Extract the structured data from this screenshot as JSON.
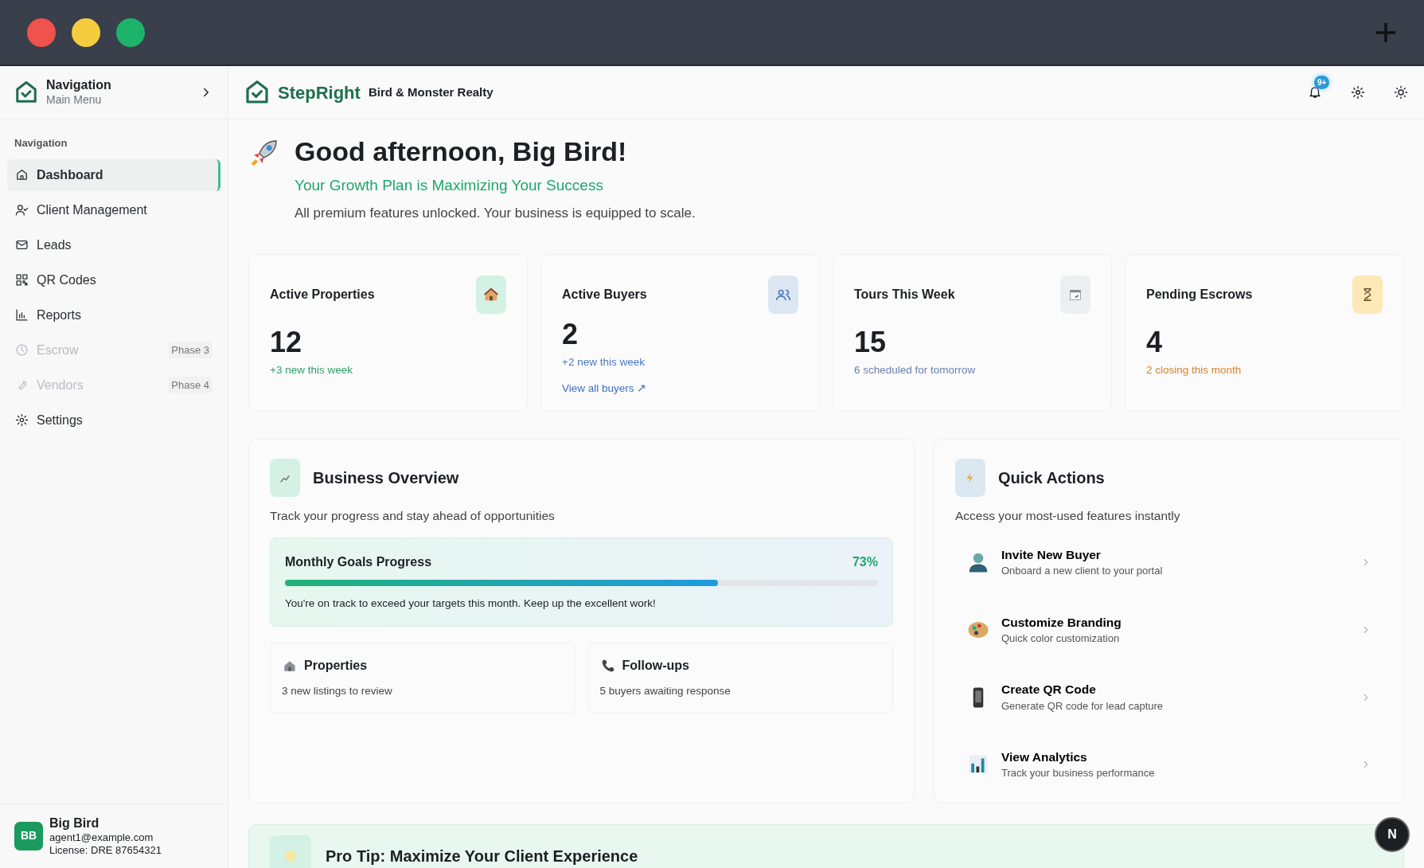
{
  "sidebar": {
    "header": {
      "title": "Navigation",
      "subtitle": "Main Menu"
    },
    "section_label": "Navigation",
    "items": [
      {
        "label": "Dashboard",
        "selected": true,
        "disabled": false
      },
      {
        "label": "Client Management",
        "selected": false,
        "disabled": false
      },
      {
        "label": "Leads",
        "selected": false,
        "disabled": false
      },
      {
        "label": "QR Codes",
        "selected": false,
        "disabled": false
      },
      {
        "label": "Reports",
        "selected": false,
        "disabled": false
      },
      {
        "label": "Escrow",
        "selected": false,
        "disabled": true,
        "badge": "Phase 3"
      },
      {
        "label": "Vendors",
        "selected": false,
        "disabled": true,
        "badge": "Phase 4"
      },
      {
        "label": "Settings",
        "selected": false,
        "disabled": false
      }
    ],
    "user": {
      "initials": "BB",
      "name": "Big Bird",
      "email": "agent1@example.com",
      "license": "License: DRE 87654321"
    }
  },
  "topbar": {
    "brand": "StepRight",
    "company": "Bird & Monster Realty",
    "notification_badge": "9+"
  },
  "greeting": {
    "title": "Good afternoon, Big Bird!",
    "subtitle": "Your Growth Plan is Maximizing Your Success",
    "description": "All premium features unlocked. Your business is equipped to scale."
  },
  "stats": [
    {
      "title": "Active Properties",
      "value": "12",
      "note": "+3 new this week",
      "color": "#2e9e6a"
    },
    {
      "title": "Active Buyers",
      "value": "2",
      "note": "+2 new this week",
      "color": "#4a78c4",
      "link": "View all buyers ↗"
    },
    {
      "title": "Tours This Week",
      "value": "15",
      "note": "6 scheduled for tomorrow",
      "color": "#6a7fb0"
    },
    {
      "title": "Pending Escrows",
      "value": "4",
      "note": "2 closing this month",
      "color": "#d9822b"
    }
  ],
  "overview": {
    "title": "Business Overview",
    "description": "Track your progress and stay ahead of opportunities",
    "goal": {
      "title": "Monthly Goals Progress",
      "percent": "73%",
      "level": 0.73,
      "message": "You're on track to exceed your targets this month. Keep up the excellent work!"
    },
    "tiles": [
      {
        "title": "Properties",
        "text": "3 new listings to review"
      },
      {
        "title": "Follow-ups",
        "text": "5 buyers awaiting response"
      }
    ]
  },
  "quick_actions": {
    "title": "Quick Actions",
    "description": "Access your most-used features instantly",
    "items": [
      {
        "title": "Invite New Buyer",
        "subtitle": "Onboard a new client to your portal"
      },
      {
        "title": "Customize Branding",
        "subtitle": "Quick color customization"
      },
      {
        "title": "Create QR Code",
        "subtitle": "Generate QR code for lead capture"
      },
      {
        "title": "View Analytics",
        "subtitle": "Track your business performance"
      }
    ]
  },
  "pro_tip": {
    "title": "Pro Tip: Maximize Your Client Experience"
  },
  "help_button": "N"
}
